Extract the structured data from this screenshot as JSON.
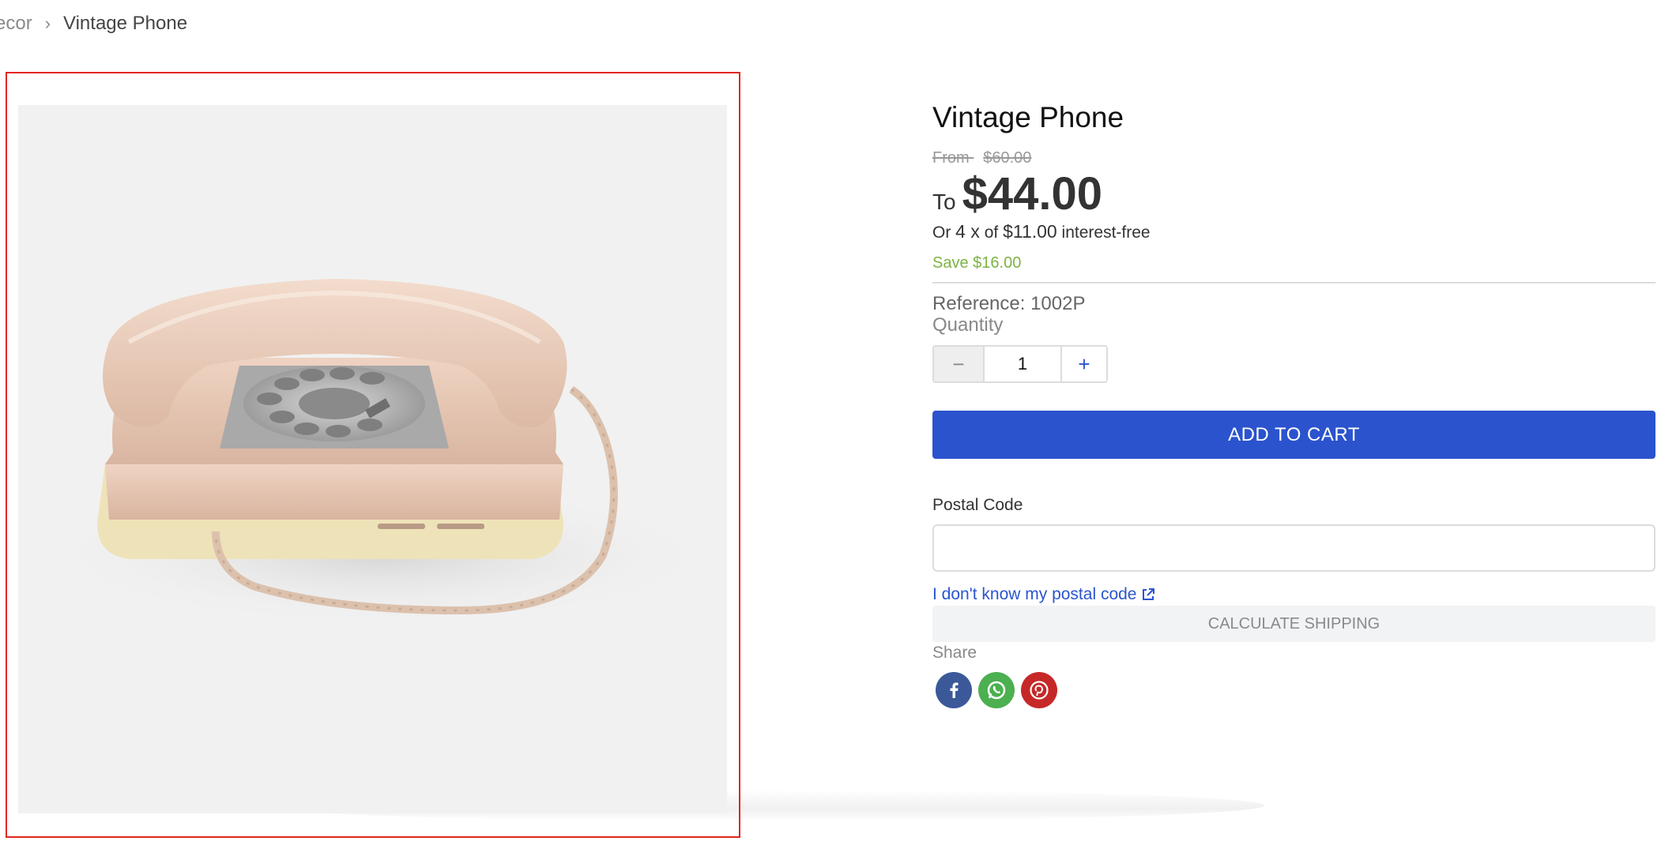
{
  "breadcrumb": {
    "previous": "ecor",
    "separator": "›",
    "current": "Vintage Phone"
  },
  "product": {
    "title": "Vintage Phone",
    "image_alt": "beige rotary phone",
    "price": {
      "from_label": "From",
      "old_price": "$60.00",
      "to_label": "To",
      "current_price": "$44.00",
      "installments_prefix": "Or",
      "installments_count": "4 x",
      "installments_of": "of",
      "installments_amount": "$11.00",
      "installments_suffix": "interest-free",
      "save_text": "Save $16.00"
    },
    "reference": "Reference: 1002P"
  },
  "quantity": {
    "label": "Quantity",
    "value": "1",
    "decrement_symbol": "−",
    "increment_symbol": "+"
  },
  "cart": {
    "add_label": "ADD TO CART"
  },
  "shipping": {
    "postal_label": "Postal Code",
    "postal_value": "",
    "postal_placeholder": "",
    "postal_link": "I don't know my postal code",
    "calculate_label": "CALCULATE SHIPPING"
  },
  "share": {
    "label": "Share",
    "icons": [
      "facebook-icon",
      "whatsapp-icon",
      "pinterest-icon"
    ]
  },
  "colors": {
    "primary_button": "#2b53cd",
    "link": "#2b55cf",
    "save_green": "#7cb342",
    "facebook": "#3b5998",
    "whatsapp": "#4caf50",
    "pinterest": "#c62828",
    "selection_frame": "#e0261e"
  }
}
